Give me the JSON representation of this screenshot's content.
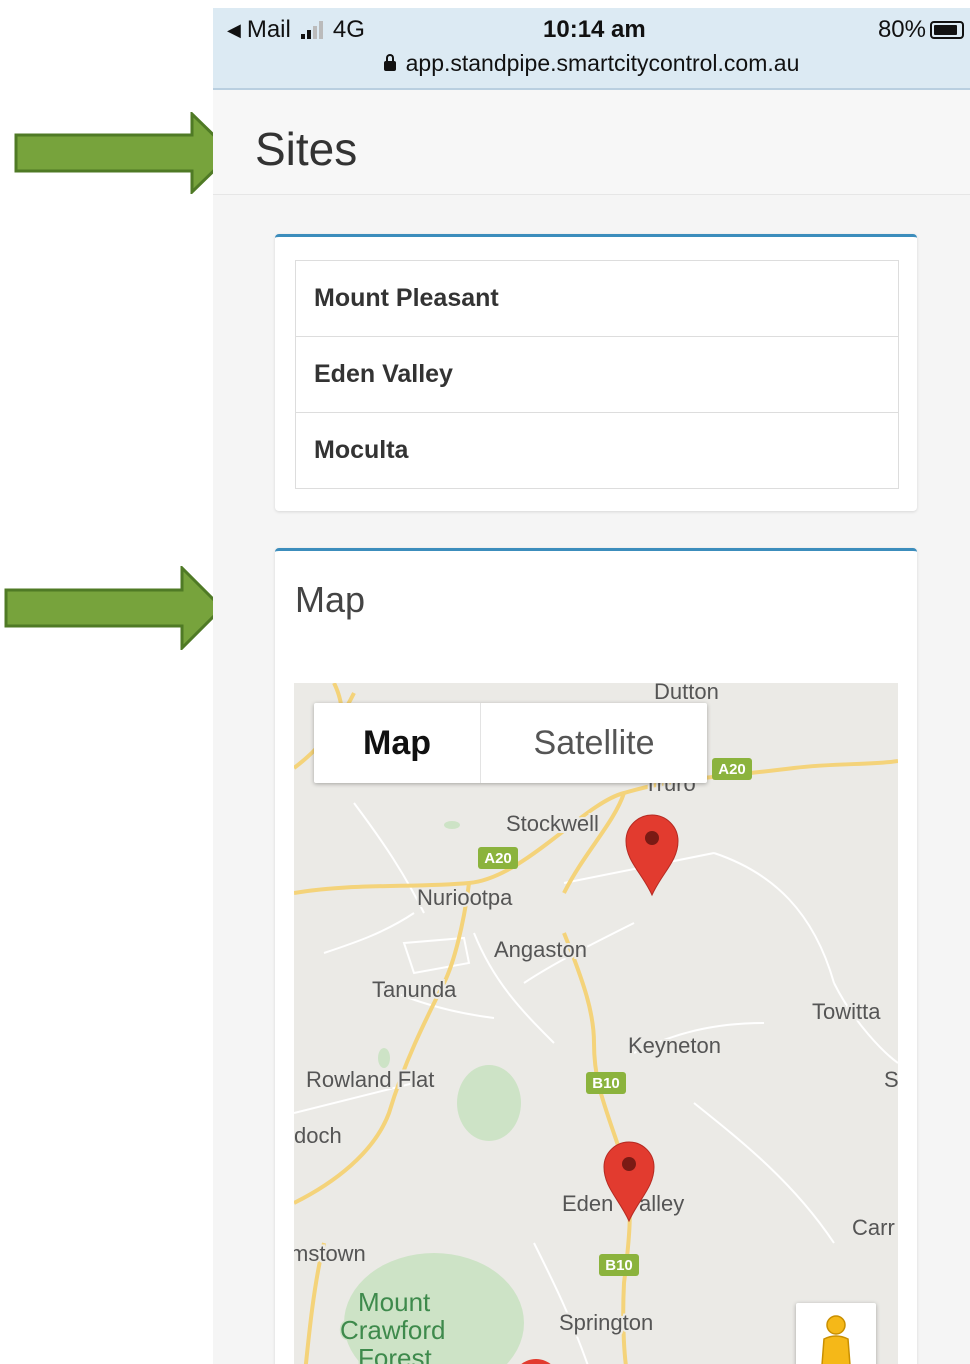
{
  "status_bar": {
    "back_app": "Mail",
    "network": "4G",
    "time": "10:14 am",
    "battery": "80%",
    "battery_level": 0.8,
    "url": "app.standpipe.smartcitycontrol.com.au"
  },
  "page": {
    "title": "Sites"
  },
  "sites": {
    "items": [
      {
        "label": "Mount Pleasant"
      },
      {
        "label": "Eden Valley"
      },
      {
        "label": "Moculta"
      }
    ]
  },
  "map_section": {
    "title": "Map",
    "map_type_options": [
      {
        "label": "Map",
        "selected": true
      },
      {
        "label": "Satellite",
        "selected": false
      }
    ],
    "place_labels": [
      "Dutton",
      "Truro",
      "Stockwell",
      "Nuriootpa",
      "Angaston",
      "Tanunda",
      "Towitta",
      "Keyneton",
      "Rowland Flat",
      "S",
      "doch",
      "Eden",
      "alley",
      "Carr",
      "mstown",
      "Mount",
      "Crawford",
      "Forest",
      "Springton"
    ],
    "road_badges": [
      "A20",
      "A20",
      "B10",
      "B10"
    ],
    "markers": [
      "red-pin",
      "red-pin"
    ],
    "pegman": "pegman-icon"
  },
  "annotations": {
    "arrow_color": "#77a33c",
    "arrow_border": "#4f7a25"
  },
  "colors": {
    "card_accent": "#3c8dbc",
    "marker": "#e23b2f",
    "road_badge": "#8bb33d"
  }
}
